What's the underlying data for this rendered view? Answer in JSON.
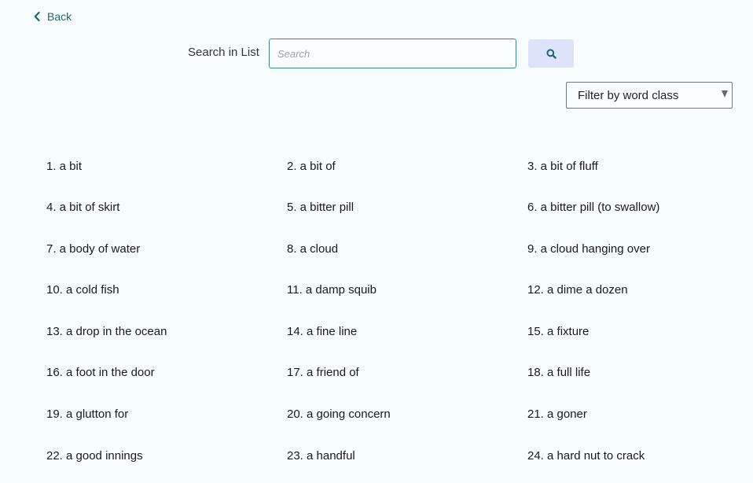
{
  "nav": {
    "back_label": "Back"
  },
  "search": {
    "label": "Search in List",
    "placeholder": "Search",
    "value": "",
    "button_icon": "search-icon"
  },
  "filter": {
    "selected": "Filter by word class"
  },
  "colors": {
    "accent": "#1f6670",
    "background": "#f7fcfc",
    "search_button_bg": "#dde3fb",
    "input_border": "#3a8a8a"
  },
  "words": [
    "1. a bit",
    "2. a bit of",
    "3. a bit of fluff",
    "4. a bit of skirt",
    "5. a bitter pill",
    "6. a bitter pill (to swallow)",
    "7. a body of water",
    "8. a cloud",
    "9. a cloud hanging over",
    "10. a cold fish",
    "11. a damp squib",
    "12. a dime a dozen",
    "13. a drop in the ocean",
    "14. a fine line",
    "15. a fixture",
    "16. a foot in the door",
    "17. a friend of",
    "18. a full life",
    "19. a glutton for",
    "20. a going concern",
    "21. a goner",
    "22. a good innings",
    "23. a handful",
    "24. a hard nut to crack"
  ]
}
